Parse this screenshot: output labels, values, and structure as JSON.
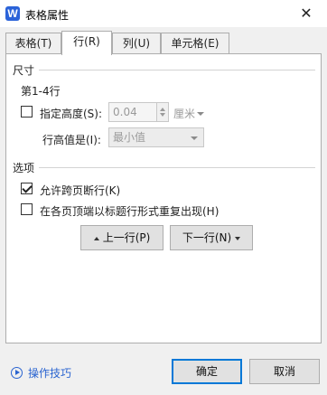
{
  "window": {
    "title": "表格属性",
    "logo_letter": "W",
    "close_glyph": "✕"
  },
  "tabs": [
    {
      "label": "表格(T)",
      "active": false
    },
    {
      "label": "行(R)",
      "active": true
    },
    {
      "label": "列(U)",
      "active": false
    },
    {
      "label": "单元格(E)",
      "active": false
    }
  ],
  "size_section": {
    "title": "尺寸",
    "rows_label": "第1-4行",
    "specify_height_label": "指定高度(S):",
    "specify_height_checked": false,
    "height_value": "0.04",
    "unit": "厘米",
    "row_height_is_label": "行高值是(I):",
    "row_height_mode": "最小值"
  },
  "options_section": {
    "title": "选项",
    "allow_break_label": "允许跨页断行(K)",
    "allow_break_checked": true,
    "repeat_header_label": "在各页顶端以标题行形式重复出现(H)",
    "repeat_header_checked": false
  },
  "nav": {
    "prev_row": "上一行(P)",
    "next_row": "下一行(N)"
  },
  "footer": {
    "tips": "操作技巧",
    "ok": "确定",
    "cancel": "取消"
  },
  "colors": {
    "accent": "#0078d7",
    "link": "#2a64d0",
    "annotation_arrow": "#e03a2f"
  }
}
